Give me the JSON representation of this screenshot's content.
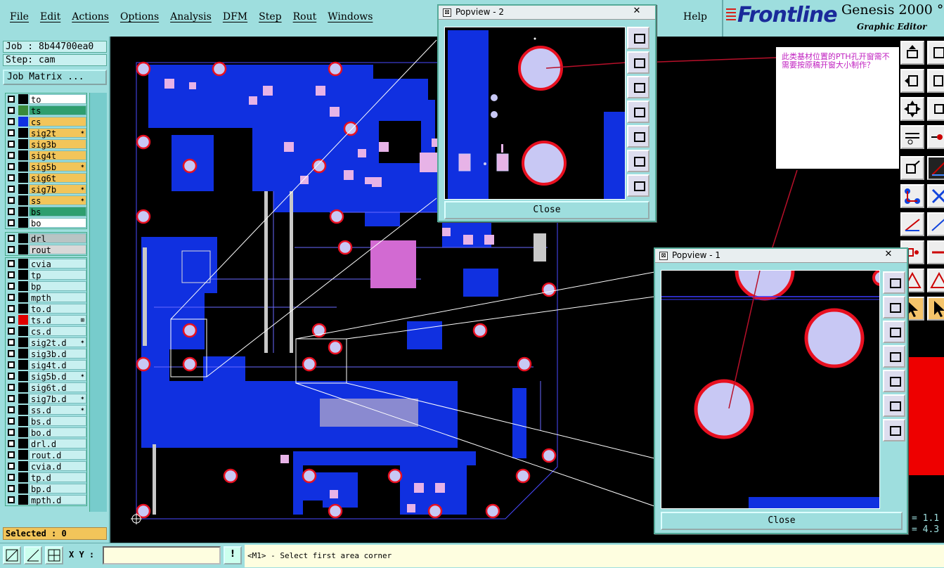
{
  "menubar": {
    "items": [
      "File",
      "Edit",
      "Actions",
      "Options",
      "Analysis",
      "DFM",
      "Step",
      "Rout",
      "Windows"
    ],
    "help": "Help"
  },
  "brand": {
    "logo": "Frontline",
    "product": "Genesis 2000 °",
    "subtitle": "Graphic Editor"
  },
  "left": {
    "job": "Job : 8b44700ea0",
    "step": "Step: cam",
    "job_matrix": "Job Matrix ...",
    "layers_board": [
      {
        "name": "to",
        "bg": "#ffffff",
        "swatch": "#000000"
      },
      {
        "name": "ts",
        "bg": "#2e9e6e",
        "swatch": "#3a8a3a"
      },
      {
        "name": "cs",
        "bg": "#f2c55a",
        "swatch": "#1030e0"
      },
      {
        "name": "sig2t",
        "bg": "#f2c55a",
        "swatch": "#000000",
        "lock": true
      },
      {
        "name": "sig3b",
        "bg": "#f2c55a",
        "swatch": "#000000"
      },
      {
        "name": "sig4t",
        "bg": "#f2c55a",
        "swatch": "#000000"
      },
      {
        "name": "sig5b",
        "bg": "#f2c55a",
        "swatch": "#000000",
        "lock": true
      },
      {
        "name": "sig6t",
        "bg": "#f2c55a",
        "swatch": "#000000"
      },
      {
        "name": "sig7b",
        "bg": "#f2c55a",
        "swatch": "#000000",
        "lock": true
      },
      {
        "name": "ss",
        "bg": "#f2c55a",
        "swatch": "#000000",
        "lock": true
      },
      {
        "name": "bs",
        "bg": "#2e9e6e",
        "swatch": "#000000"
      },
      {
        "name": "bo",
        "bg": "#ffffff",
        "swatch": "#000000"
      }
    ],
    "layers_drill": [
      {
        "name": "drl",
        "bg": "#b8c4c4",
        "swatch": "#000000"
      },
      {
        "name": "rout",
        "bg": "#d8d8d8",
        "swatch": "#000000"
      }
    ],
    "layers_misc": [
      {
        "name": "cvia",
        "bg": "#c8f0f0",
        "swatch": "#000000"
      },
      {
        "name": "tp",
        "bg": "#c8f0f0",
        "swatch": "#000000"
      },
      {
        "name": "bp",
        "bg": "#c8f0f0",
        "swatch": "#000000"
      },
      {
        "name": "mpth",
        "bg": "#c8f0f0",
        "swatch": "#000000"
      },
      {
        "name": "to.d",
        "bg": "#c8f0f0",
        "swatch": "#000000"
      },
      {
        "name": "ts.d",
        "bg": "#c8f0f0",
        "swatch": "#e00000",
        "mark": true
      },
      {
        "name": "cs.d",
        "bg": "#c8f0f0",
        "swatch": "#000000"
      },
      {
        "name": "sig2t.d",
        "bg": "#c8f0f0",
        "swatch": "#000000",
        "lock": true
      },
      {
        "name": "sig3b.d",
        "bg": "#c8f0f0",
        "swatch": "#000000"
      },
      {
        "name": "sig4t.d",
        "bg": "#c8f0f0",
        "swatch": "#000000"
      },
      {
        "name": "sig5b.d",
        "bg": "#c8f0f0",
        "swatch": "#000000",
        "lock": true
      },
      {
        "name": "sig6t.d",
        "bg": "#c8f0f0",
        "swatch": "#000000"
      },
      {
        "name": "sig7b.d",
        "bg": "#c8f0f0",
        "swatch": "#000000",
        "lock": true
      },
      {
        "name": "ss.d",
        "bg": "#c8f0f0",
        "swatch": "#000000",
        "lock": true
      },
      {
        "name": "bs.d",
        "bg": "#c8f0f0",
        "swatch": "#000000"
      },
      {
        "name": "bo.d",
        "bg": "#c8f0f0",
        "swatch": "#000000"
      },
      {
        "name": "drl.d",
        "bg": "#c8f0f0",
        "swatch": "#000000"
      },
      {
        "name": "rout.d",
        "bg": "#c8f0f0",
        "swatch": "#000000"
      },
      {
        "name": "cvia.d",
        "bg": "#c8f0f0",
        "swatch": "#000000"
      },
      {
        "name": "tp.d",
        "bg": "#c8f0f0",
        "swatch": "#000000"
      },
      {
        "name": "bp.d",
        "bg": "#c8f0f0",
        "swatch": "#000000"
      },
      {
        "name": "mpth.d",
        "bg": "#c8f0f0",
        "swatch": "#000000"
      }
    ],
    "selected": "Selected : 0"
  },
  "bottom": {
    "xy_label": "X Y :",
    "xy_value": "",
    "status": "<M1> - Select first area corner",
    "buttons": [
      "zoom-area-icon",
      "measure-icon",
      "snap-grid-icon"
    ],
    "alert_icon": "!"
  },
  "coords": {
    "line1": "= 1.1",
    "line2": "= 4.3"
  },
  "popview2": {
    "title": "Popview - 2",
    "close": "Close",
    "close_x": "✕"
  },
  "popview1": {
    "title": "Popview - 1",
    "close": "Close",
    "close_x": "✕"
  },
  "note": {
    "text": "此类基材位置的PTH孔开窗需不需要按原稿开窗大小制作？"
  },
  "colors": {
    "panel": "#9edede",
    "copper": "#1030e0",
    "pad_fill": "#b8b8f0",
    "pad_ring": "#e81020",
    "annotation": "#c020c0"
  }
}
